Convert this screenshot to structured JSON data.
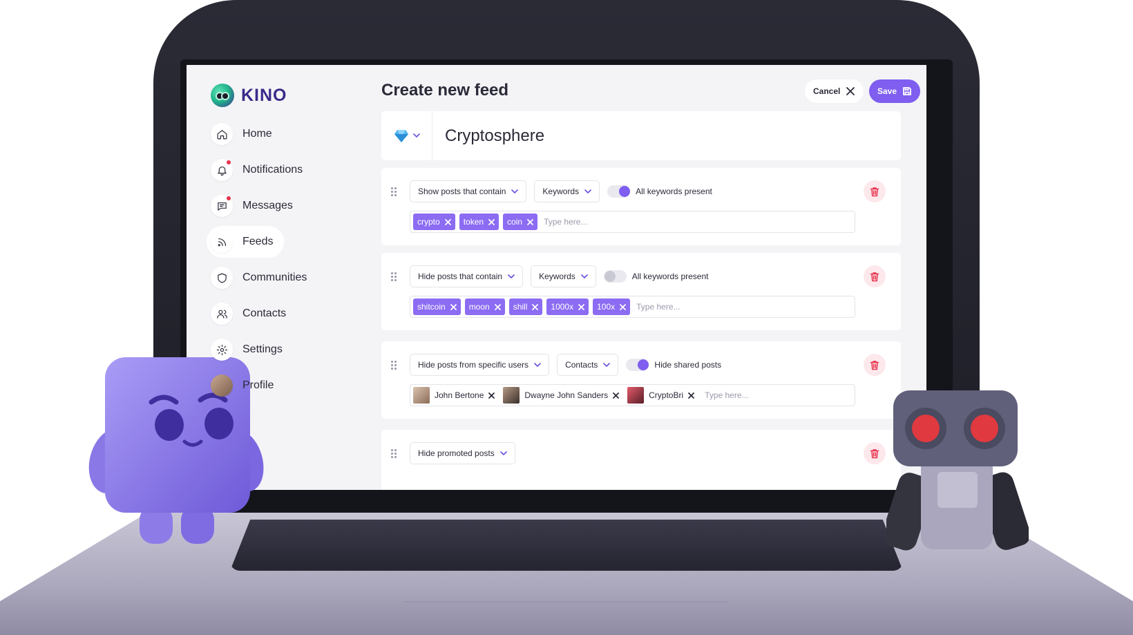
{
  "app": {
    "name": "KINO"
  },
  "sidebar": {
    "items": [
      {
        "label": "Home",
        "icon": "home-icon",
        "badge": false,
        "active": false
      },
      {
        "label": "Notifications",
        "icon": "bell-icon",
        "badge": true,
        "active": false
      },
      {
        "label": "Messages",
        "icon": "message-icon",
        "badge": true,
        "active": false
      },
      {
        "label": "Feeds",
        "icon": "rss-icon",
        "badge": false,
        "active": true
      },
      {
        "label": "Communities",
        "icon": "shield-icon",
        "badge": false,
        "active": false
      },
      {
        "label": "Contacts",
        "icon": "users-icon",
        "badge": false,
        "active": false
      },
      {
        "label": "Settings",
        "icon": "gear-icon",
        "badge": false,
        "active": false
      },
      {
        "label": "Profile",
        "icon": "avatar",
        "badge": false,
        "active": false
      }
    ]
  },
  "header": {
    "title": "Create new feed",
    "cancel_label": "Cancel",
    "save_label": "Save"
  },
  "feed": {
    "emoji": "gem-icon",
    "name": "Cryptosphere"
  },
  "rules": [
    {
      "action": "Show posts that contain",
      "type": "Keywords",
      "toggle_label": "All keywords present",
      "toggle_on": true,
      "tags": [
        "crypto",
        "token",
        "coin"
      ],
      "placeholder": "Type here..."
    },
    {
      "action": "Hide posts that contain",
      "type": "Keywords",
      "toggle_label": "All keywords present",
      "toggle_on": false,
      "tags": [
        "shitcoin",
        "moon",
        "shill",
        "1000x",
        "100x"
      ],
      "placeholder": "Type here..."
    },
    {
      "action": "Hide posts from specific users",
      "type": "Contacts",
      "toggle_label": "Hide shared posts",
      "toggle_on": true,
      "users": [
        "John Bertone",
        "Dwayne John Sanders",
        "CryptoBri"
      ],
      "placeholder": "Type here..."
    },
    {
      "action": "Hide promoted posts"
    }
  ],
  "colors": {
    "accent": "#7f5ef0",
    "tag_bg": "#8b6cf2",
    "danger": "#e8334d",
    "danger_bg": "#fde8ec",
    "screen_bg": "#f4f4f7",
    "laptop_body": "#1e1e27"
  }
}
